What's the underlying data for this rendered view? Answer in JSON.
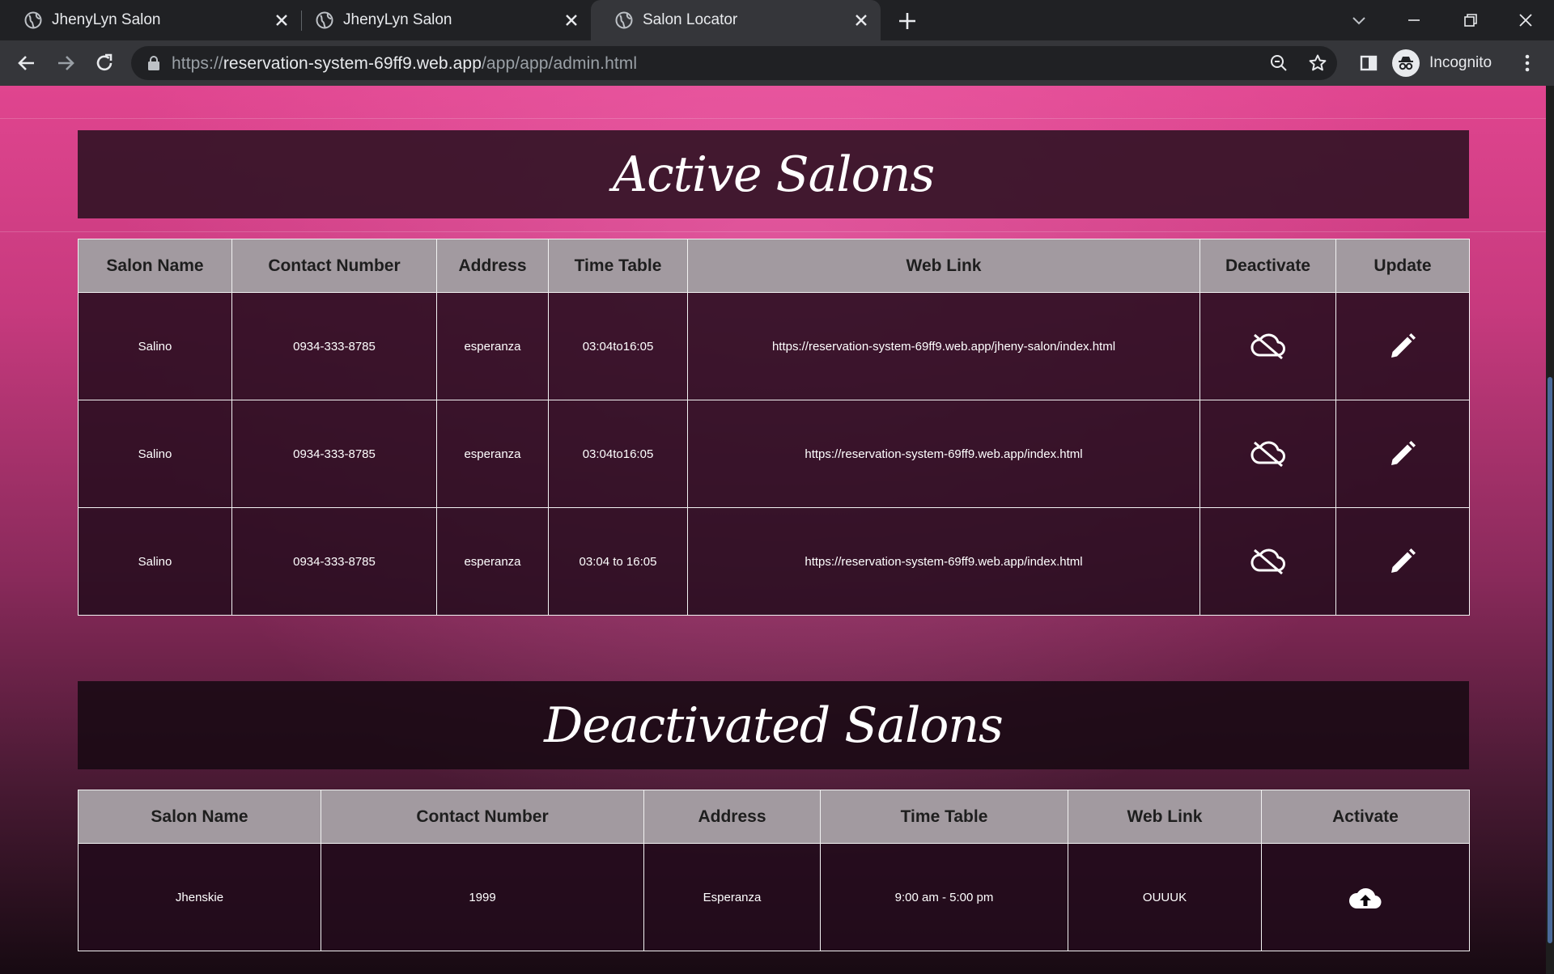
{
  "browser": {
    "tabs": [
      {
        "title": "JhenyLyn Salon",
        "active": false
      },
      {
        "title": "JhenyLyn Salon",
        "active": false
      },
      {
        "title": "Salon Locator",
        "active": true
      }
    ],
    "url_prefix": "https://",
    "url_host": "reservation-system-69ff9.web.app",
    "url_path": "/app/app/admin.html",
    "profile_label": "Incognito"
  },
  "active_section": {
    "heading": "Active Salons",
    "headers": [
      "Salon Name",
      "Contact Number",
      "Address",
      "Time Table",
      "Web Link",
      "Deactivate",
      "Update"
    ],
    "rows": [
      {
        "name": "Salino",
        "contact": "0934-333-8785",
        "address": "esperanza",
        "time": "03:04to16:05",
        "link": "https://reservation-system-69ff9.web.app/jheny-salon/index.html",
        "deactivate_icon": "cloud-off-icon",
        "update_icon": "pencil-icon"
      },
      {
        "name": "Salino",
        "contact": "0934-333-8785",
        "address": "esperanza",
        "time": "03:04to16:05",
        "link": "https://reservation-system-69ff9.web.app/index.html",
        "deactivate_icon": "cloud-off-icon",
        "update_icon": "pencil-icon"
      },
      {
        "name": "Salino",
        "contact": "0934-333-8785",
        "address": "esperanza",
        "time": "03:04 to 16:05",
        "link": "https://reservation-system-69ff9.web.app/index.html",
        "deactivate_icon": "cloud-off-icon",
        "update_icon": "pencil-icon"
      }
    ]
  },
  "deactivated_section": {
    "heading": "Deactivated Salons",
    "headers": [
      "Salon Name",
      "Contact Number",
      "Address",
      "Time Table",
      "Web Link",
      "Activate"
    ],
    "rows": [
      {
        "name": "Jhenskie",
        "contact": "1999",
        "address": "Esperanza",
        "time": "9:00 am - 5:00 pm",
        "link": "OUUUK",
        "activate_icon": "cloud-upload-icon"
      }
    ]
  },
  "colors": {
    "header_cell": "#a29aa0",
    "page_pink": "#e0458f",
    "chrome_dark": "#202124",
    "chrome_toolbar": "#35363a"
  }
}
